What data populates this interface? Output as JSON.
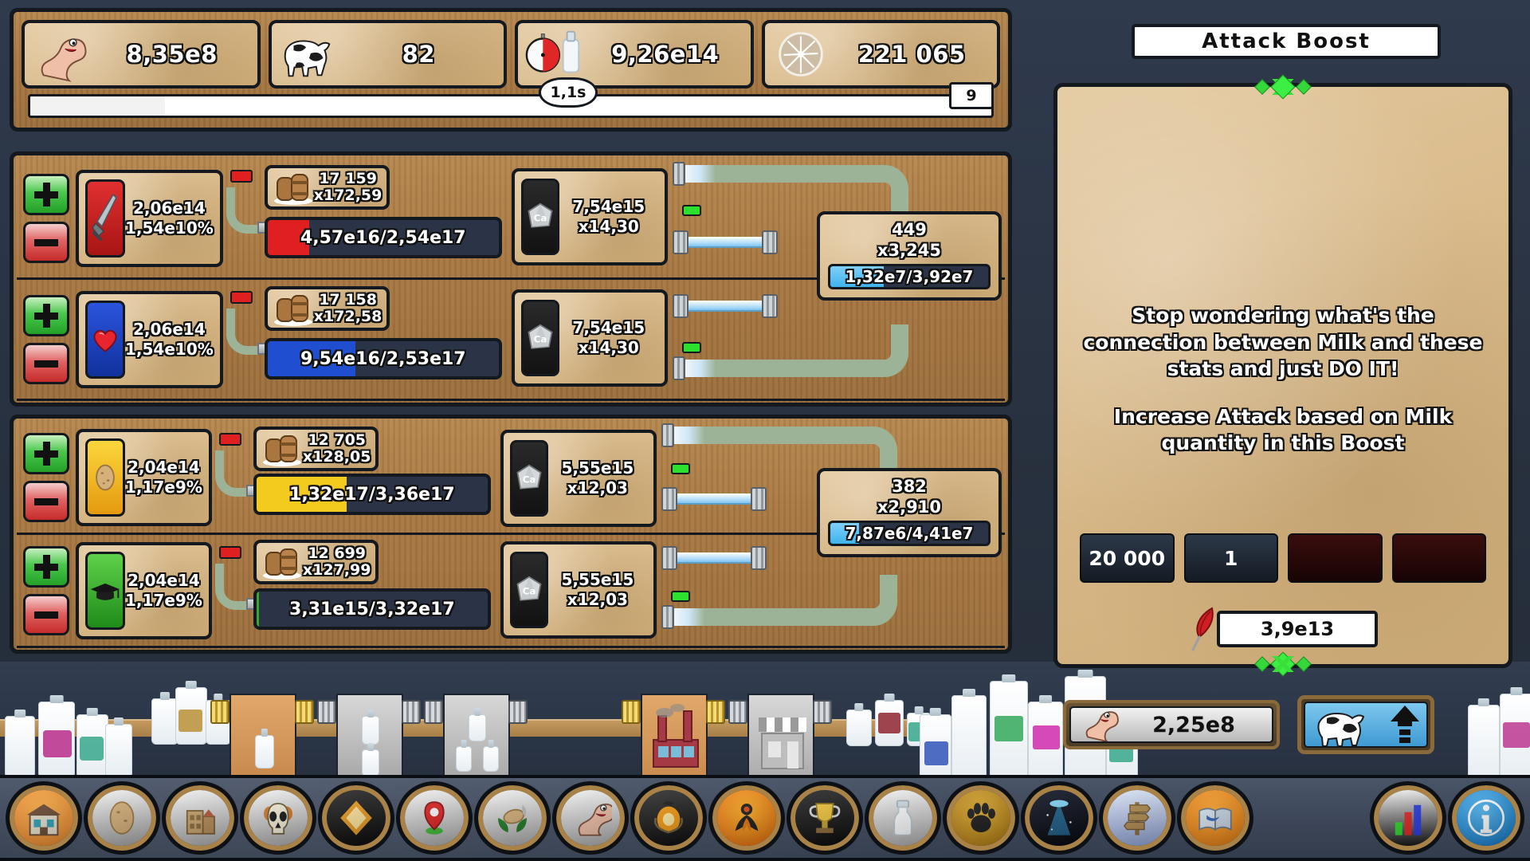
{
  "header": {
    "resources": [
      {
        "icon": "worm-icon",
        "label": "worms",
        "value": "8,35e8"
      },
      {
        "icon": "cow-icon",
        "label": "cows",
        "value": "82"
      },
      {
        "icon": "timer-milk-icon",
        "label": "milk",
        "value": "9,26e14",
        "timer": "1,1s"
      },
      {
        "icon": "shatter-icon",
        "label": "shards",
        "value": "221 065"
      }
    ],
    "level_badge": "9",
    "xp_percent": 14
  },
  "production_groups": [
    {
      "id": "group-a",
      "rows": [
        {
          "stat_icon": "sword-icon",
          "stat_color": "#cf2020",
          "stat_value": "2,06e14",
          "stat_bonus": "1,54e10%",
          "barrel_count": "17 159",
          "barrel_mult": "x172,59",
          "meter_text": "4,57e16/2,54e17",
          "meter_fill_percent": 18,
          "meter_fill_color": "#e02020",
          "ca_value": "7,54e15",
          "ca_mult": "x14,30"
        },
        {
          "stat_icon": "heart-icon",
          "stat_color": "#1e3fc8",
          "stat_value": "2,06e14",
          "stat_bonus": "1,54e10%",
          "barrel_count": "17 158",
          "barrel_mult": "x172,58",
          "meter_text": "9,54e16/2,53e17",
          "meter_fill_percent": 38,
          "meter_fill_color": "#1f4fd0",
          "ca_value": "7,54e15",
          "ca_mult": "x14,30"
        }
      ],
      "total": {
        "count": "449",
        "mult": "x3,245",
        "meter_text": "1,32e7/3,92e7",
        "meter_fill_percent": 34
      }
    },
    {
      "id": "group-b",
      "rows": [
        {
          "stat_icon": "potato-icon",
          "stat_color": "#f0c020",
          "stat_value": "2,04e14",
          "stat_bonus": "1,17e9%",
          "barrel_count": "12 705",
          "barrel_mult": "x128,05",
          "meter_text": "1,32e17/3,36e17",
          "meter_fill_percent": 39,
          "meter_fill_color": "#f2cb1e",
          "ca_value": "5,55e15",
          "ca_mult": "x12,03"
        },
        {
          "stat_icon": "graduation-cap-icon",
          "stat_color": "#3aa82e",
          "stat_value": "2,04e14",
          "stat_bonus": "1,17e9%",
          "barrel_count": "12 699",
          "barrel_mult": "x127,99",
          "meter_text": "3,31e15/3,32e17",
          "meter_fill_percent": 1,
          "meter_fill_color": "#3aa82e",
          "ca_value": "5,55e15",
          "ca_mult": "x12,03"
        }
      ],
      "total": {
        "count": "382",
        "mult": "x2,910",
        "meter_text": "7,87e6/4,41e7",
        "meter_fill_percent": 18
      }
    }
  ],
  "right_panel": {
    "title": "Attack Boost",
    "description_line_1": "Stop wondering what's the connection between Milk and these stats and just DO IT!",
    "description_line_2": "Increase Attack based on Milk quantity in this Boost",
    "buttons": [
      {
        "label": "20 000",
        "style": "dark"
      },
      {
        "label": "1",
        "style": "dark"
      },
      {
        "label": "",
        "style": "red"
      },
      {
        "label": "",
        "style": "red"
      }
    ],
    "quill_value": "3,9e13",
    "quill_icon": "red-feather-quill-icon"
  },
  "bottom_bar": {
    "worm_counter": {
      "icon": "worm-icon",
      "value": "2,25e8"
    },
    "cow_upgrade_button": {
      "icon": "cow-up-arrow-icon",
      "label": ""
    }
  },
  "navbar": {
    "items": [
      {
        "name": "nav-tavern",
        "icon": "tavern-house-icon",
        "bg": "#e8882a"
      },
      {
        "name": "nav-potato",
        "icon": "potato-icon",
        "bg": "#c9c9c9"
      },
      {
        "name": "nav-buildings",
        "icon": "buildings-icon",
        "bg": "#cfcfcf"
      },
      {
        "name": "nav-skull",
        "icon": "skull-icon",
        "bg": "#d2d2d2"
      },
      {
        "name": "nav-diamond",
        "icon": "diamond-icon",
        "bg": "#1a1a1a"
      },
      {
        "name": "nav-map-pin",
        "icon": "map-pin-icon",
        "bg": "#cfcfcf"
      },
      {
        "name": "nav-laurel",
        "icon": "laurel-potato-icon",
        "bg": "#cfcfcf"
      },
      {
        "name": "nav-worm",
        "icon": "worm-icon",
        "bg": "#cfcfcf"
      },
      {
        "name": "nav-forge",
        "icon": "orange-orb-icon",
        "bg": "#1c1c1c"
      },
      {
        "name": "nav-phoenix",
        "icon": "phoenix-icon",
        "bg": "#f07818"
      },
      {
        "name": "nav-trophy",
        "icon": "trophy-icon",
        "bg": "#1b1b1b"
      },
      {
        "name": "nav-milk",
        "icon": "milk-bottle-icon",
        "bg": "#cfcfcf"
      },
      {
        "name": "nav-paw",
        "icon": "bear-paw-icon",
        "bg": "#c58a1e"
      },
      {
        "name": "nav-ufo",
        "icon": "ufo-icon",
        "bg": "#0b1020"
      },
      {
        "name": "nav-signpost",
        "icon": "signpost-icon",
        "bg": "#b8c4e8"
      },
      {
        "name": "nav-book",
        "icon": "spellbook-icon",
        "bg": "#ef8a1c"
      },
      {
        "name": "nav-stats",
        "icon": "bar-chart-icon",
        "bg": "#d3d3d3"
      },
      {
        "name": "nav-info",
        "icon": "info-icon",
        "bg": "#1287d8"
      }
    ]
  },
  "colors": {
    "panel_border": "#14181f",
    "parchment": "#dcc094",
    "wood": "#a9793f",
    "green_led": "#2ee02e",
    "red_led": "#e02020",
    "accent_blue": "#3fb3ec"
  }
}
